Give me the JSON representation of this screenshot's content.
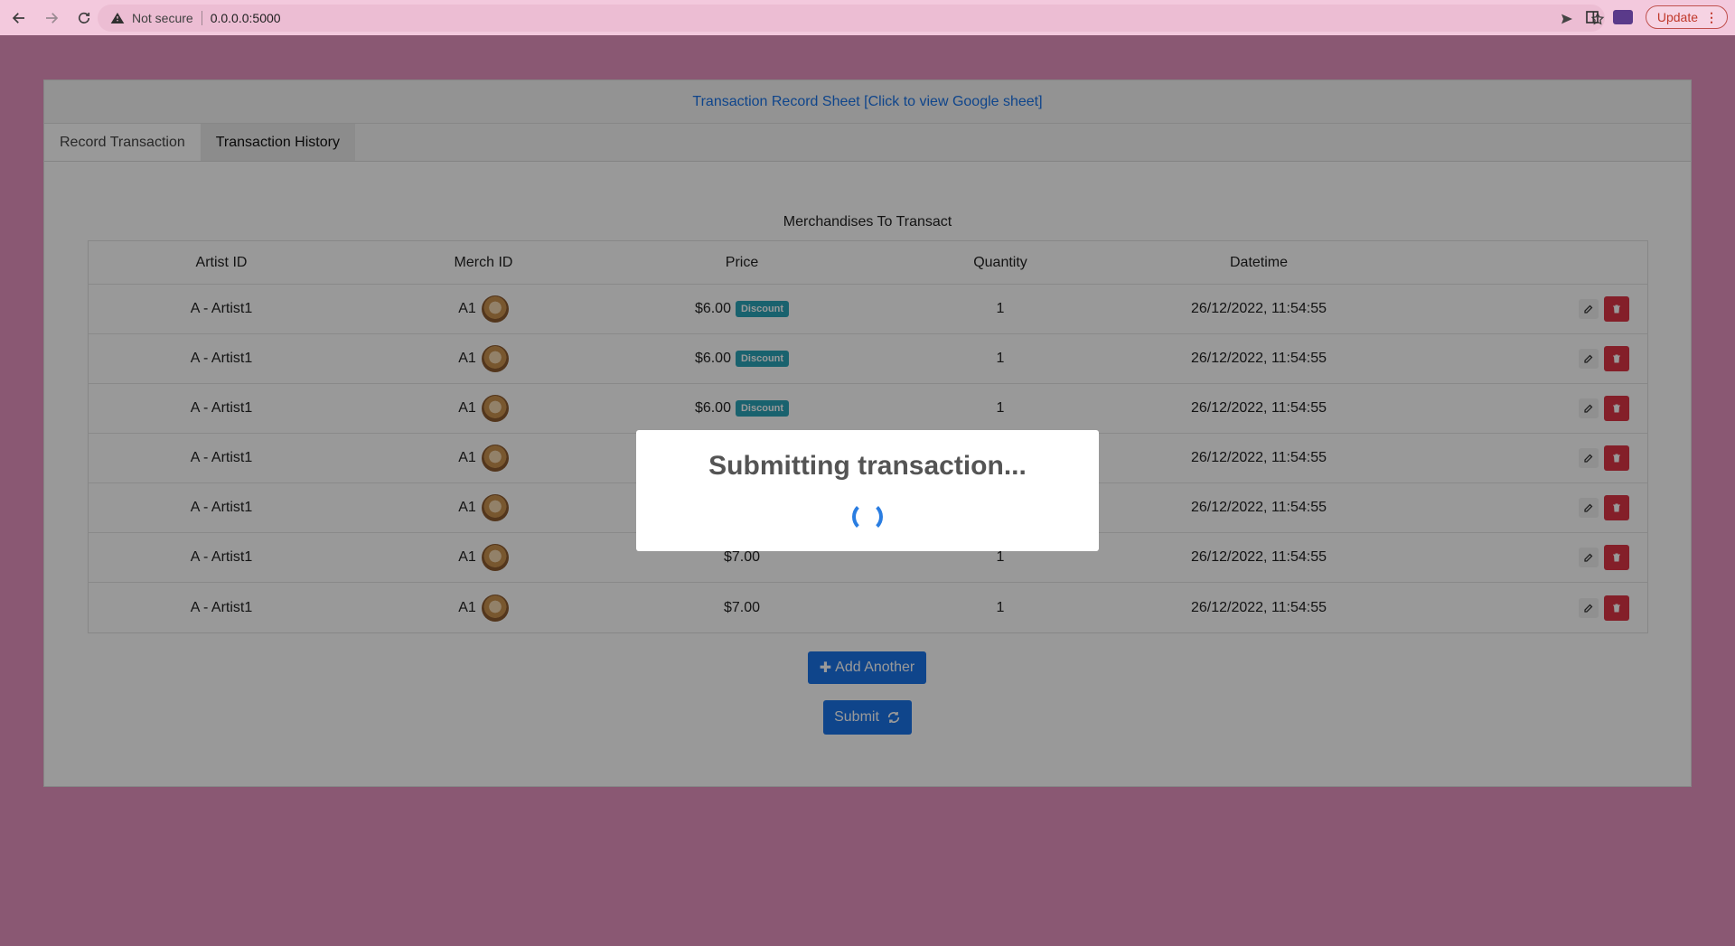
{
  "browser": {
    "not_secure": "Not secure",
    "url": "0.0.0.0:5000",
    "update_label": "Update"
  },
  "header": {
    "link_text": "Transaction Record Sheet [Click to view Google sheet]"
  },
  "tabs": [
    {
      "label": "Record Transaction"
    },
    {
      "label": "Transaction History"
    }
  ],
  "table": {
    "title": "Merchandises To Transact",
    "columns": [
      "Artist ID",
      "Merch ID",
      "Price",
      "Quantity",
      "Datetime"
    ],
    "rows": [
      {
        "artist": "A - Artist1",
        "merch": "A1",
        "price": "$6.00",
        "badge": "Discount",
        "qty": "1",
        "datetime": "26/12/2022, 11:54:55"
      },
      {
        "artist": "A - Artist1",
        "merch": "A1",
        "price": "$6.00",
        "badge": "Discount",
        "qty": "1",
        "datetime": "26/12/2022, 11:54:55"
      },
      {
        "artist": "A - Artist1",
        "merch": "A1",
        "price": "$6.00",
        "badge": "Discount",
        "qty": "1",
        "datetime": "26/12/2022, 11:54:55"
      },
      {
        "artist": "A - Artist1",
        "merch": "A1",
        "price": "",
        "badge": "",
        "qty": "",
        "datetime": "26/12/2022, 11:54:55"
      },
      {
        "artist": "A - Artist1",
        "merch": "A1",
        "price": "",
        "badge": "",
        "qty": "",
        "datetime": "26/12/2022, 11:54:55"
      },
      {
        "artist": "A - Artist1",
        "merch": "A1",
        "price": "$7.00",
        "badge": "",
        "qty": "1",
        "datetime": "26/12/2022, 11:54:55"
      },
      {
        "artist": "A - Artist1",
        "merch": "A1",
        "price": "$7.00",
        "badge": "",
        "qty": "1",
        "datetime": "26/12/2022, 11:54:55"
      }
    ]
  },
  "actions": {
    "add_label": "Add Another",
    "submit_label": "Submit"
  },
  "modal": {
    "title": "Submitting transaction..."
  },
  "colors": {
    "page_bg": "#e693c0",
    "primary": "#1a73e8",
    "danger": "#dc3545",
    "badge": "#2aa3b8"
  }
}
